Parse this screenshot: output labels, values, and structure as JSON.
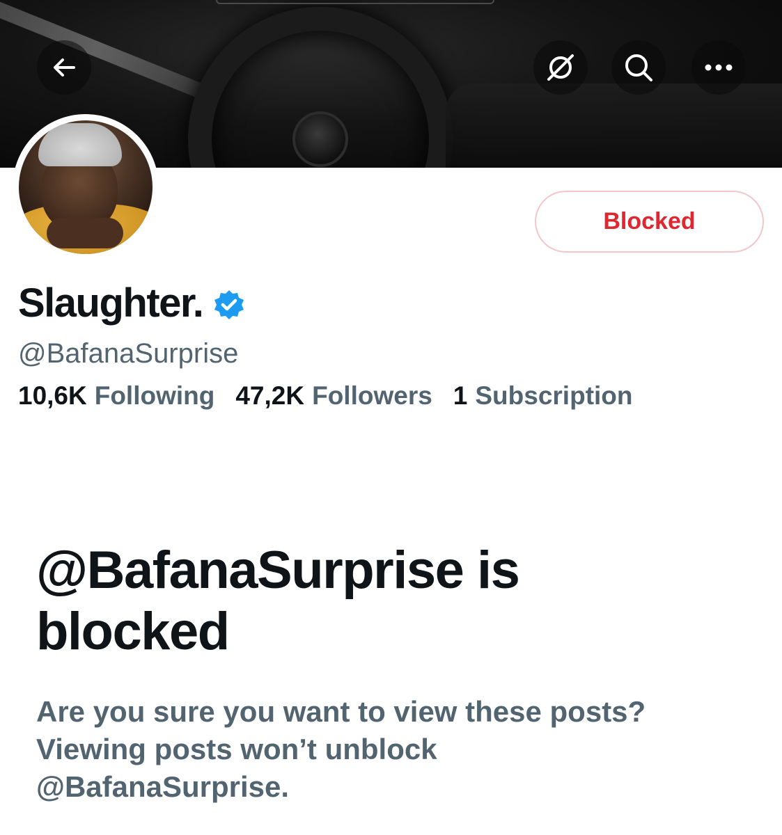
{
  "header": {
    "back_icon": "back-arrow-icon",
    "grok_icon": "grok-icon",
    "search_icon": "search-icon",
    "more_icon": "more-icon"
  },
  "profile": {
    "display_name": "Slaughter.",
    "verified": true,
    "handle": "@BafanaSurprise",
    "blocked_button_label": "Blocked",
    "stats": [
      {
        "value": "10,6K",
        "label": "Following"
      },
      {
        "value": "47,2K",
        "label": "Followers"
      },
      {
        "value": "1",
        "label": "Subscription"
      }
    ]
  },
  "notice": {
    "title": "@BafanaSurprise is blocked",
    "body_line1": "Are you sure you want to view these posts?",
    "body_line2": "Viewing posts won’t unblock",
    "body_line3": "@BafanaSurprise."
  },
  "colors": {
    "blocked_red": "#e0262f",
    "secondary_text": "#536471",
    "verified_blue": "#1d9bf0"
  }
}
